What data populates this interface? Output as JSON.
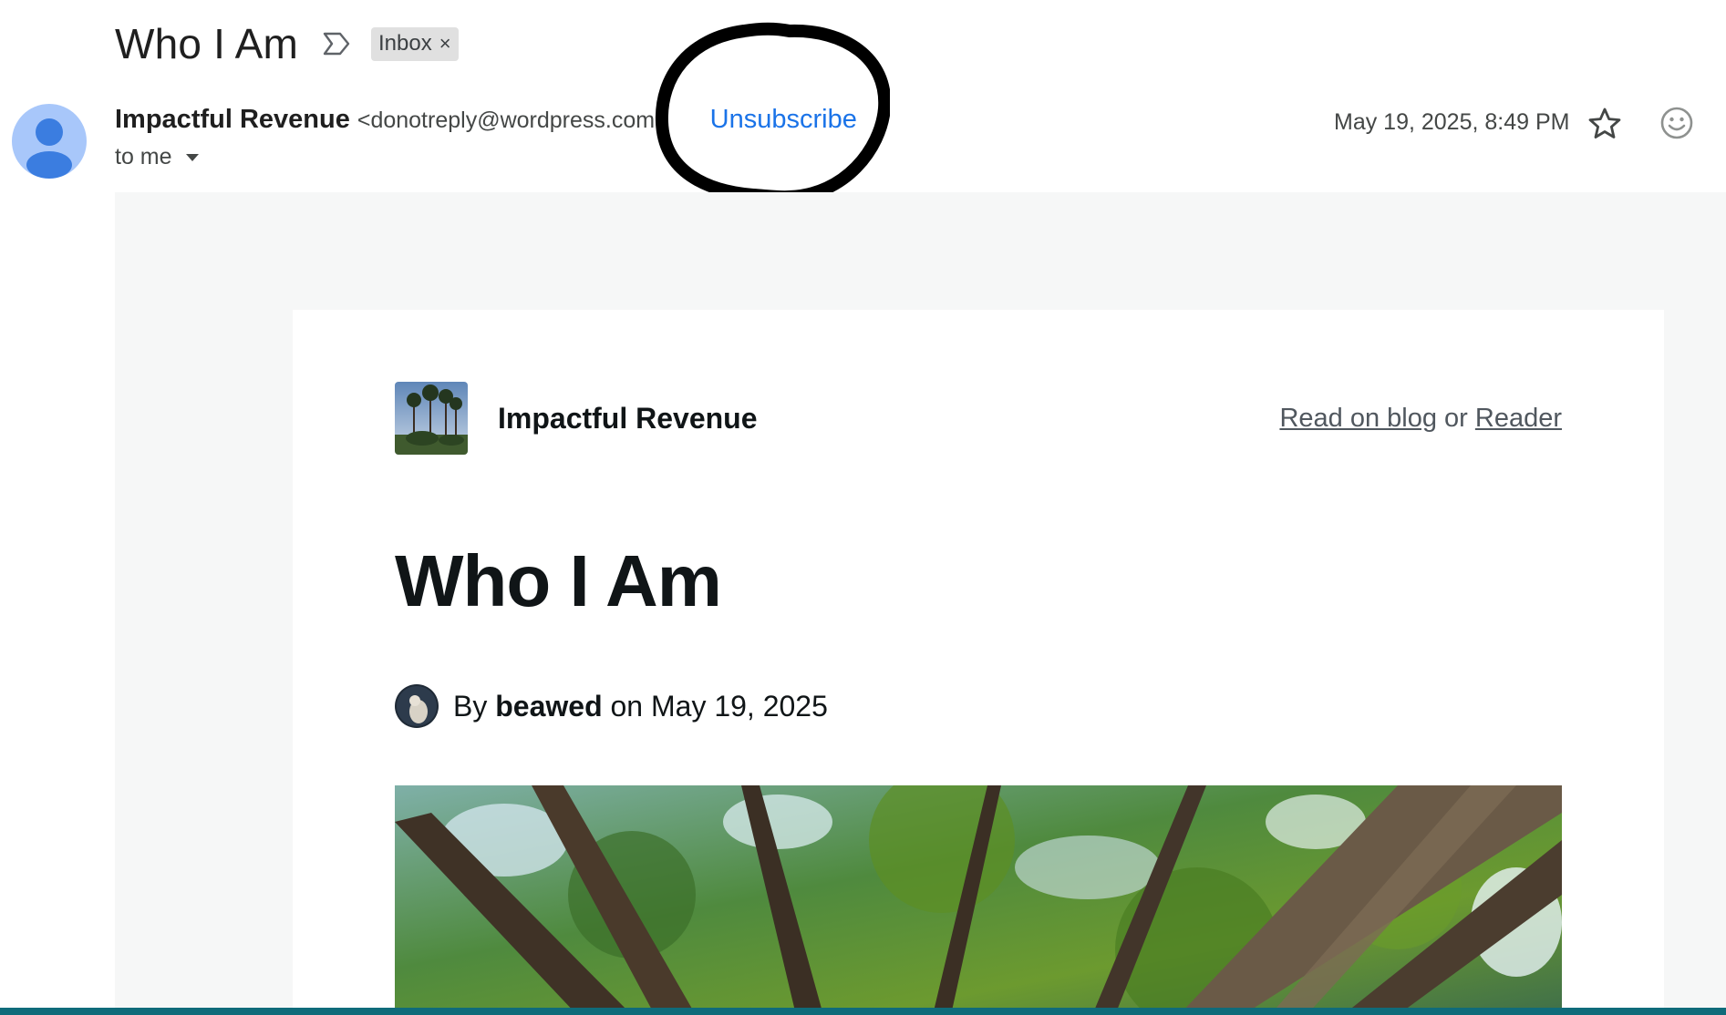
{
  "email": {
    "subject": "Who I Am",
    "label_chip": "Inbox",
    "label_chip_remove": "×",
    "sender_name": "Impactful Revenue",
    "sender_email": "<donotreply@wordpress.com>",
    "unsubscribe": "Unsubscribe",
    "recipient": "to me",
    "date": "May 19, 2025, 8:49 PM",
    "icons": {
      "important": "label-arrow-icon",
      "star": "star-icon",
      "emoji": "emoji-reaction-icon",
      "caret": "caret-down-icon",
      "avatar": "person-avatar-icon"
    },
    "colors": {
      "link_blue": "#1a73e8",
      "avatar_bg": "#a8c7fa",
      "avatar_fg": "#3b7de0",
      "body_bg": "#f6f7f7"
    }
  },
  "newsletter": {
    "blog_name": "Impactful Revenue",
    "read_on_blog": "Read on blog",
    "or_text": " or ",
    "reader": "Reader",
    "post_title": "Who I Am",
    "byline_prefix": "By ",
    "author": "beawed",
    "byline_suffix": " on May 19, 2025"
  }
}
